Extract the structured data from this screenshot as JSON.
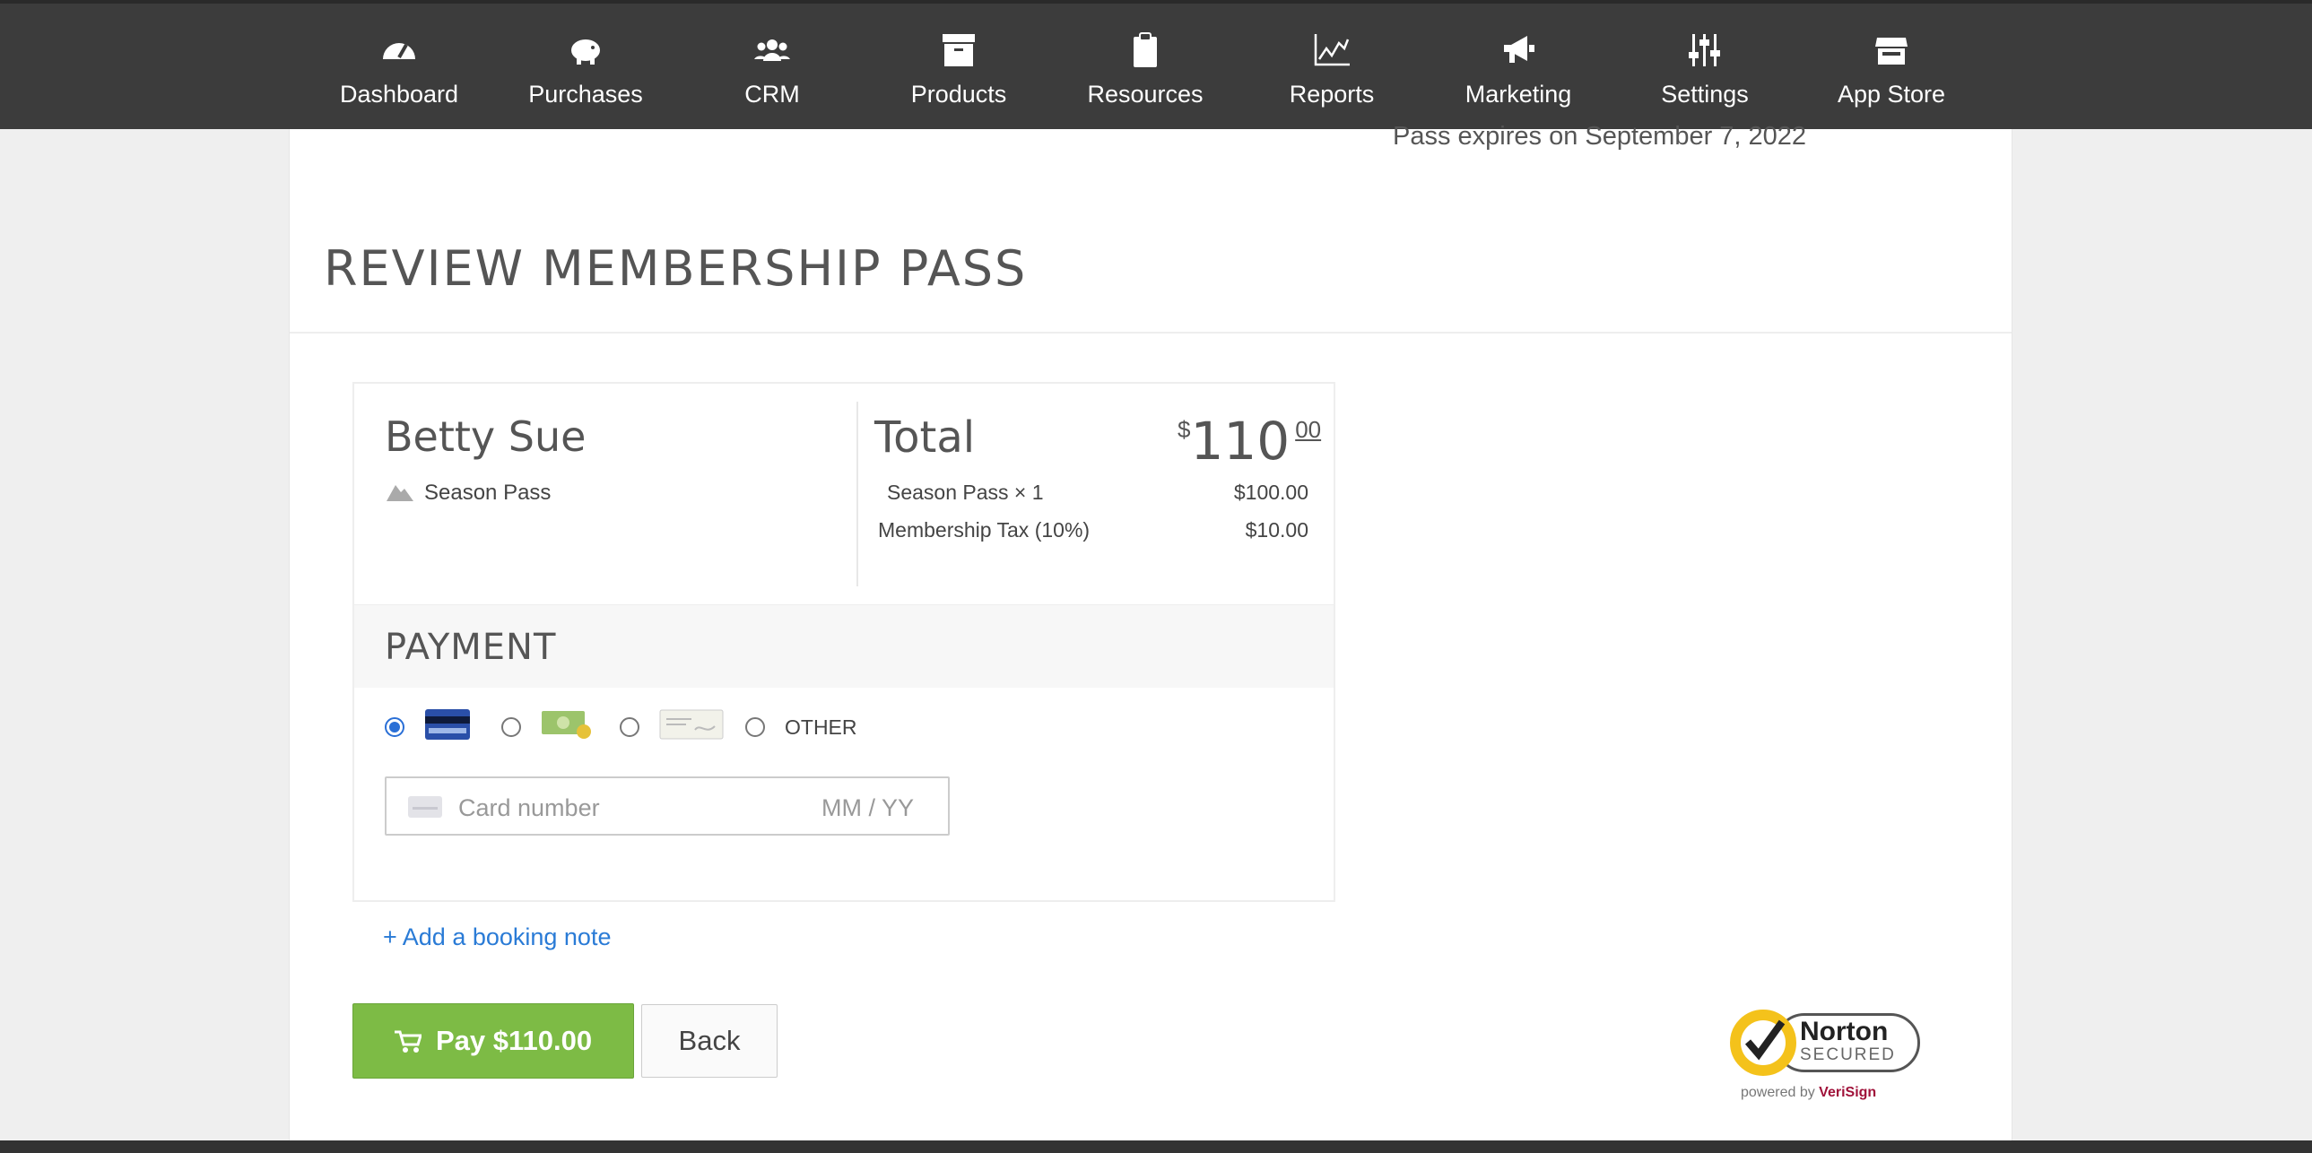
{
  "nav": {
    "items": [
      {
        "label": "Dashboard",
        "icon": "dashboard-gauge-icon"
      },
      {
        "label": "Purchases",
        "icon": "piggy-bank-icon"
      },
      {
        "label": "CRM",
        "icon": "people-icon"
      },
      {
        "label": "Products",
        "icon": "archive-box-icon"
      },
      {
        "label": "Resources",
        "icon": "clipboard-icon"
      },
      {
        "label": "Reports",
        "icon": "line-chart-icon"
      },
      {
        "label": "Marketing",
        "icon": "megaphone-icon"
      },
      {
        "label": "Settings",
        "icon": "sliders-icon"
      },
      {
        "label": "App Store",
        "icon": "storefront-icon"
      }
    ]
  },
  "header": {
    "expires": "Pass expires on September 7, 2022",
    "title": "REVIEW MEMBERSHIP PASS"
  },
  "summary": {
    "customer_name": "Betty Sue",
    "pass_name": "Season Pass",
    "total_label": "Total",
    "currency_symbol": "$",
    "total_int": "110",
    "total_cents": "00",
    "lines": [
      {
        "label": "Season Pass × 1",
        "amount": "$100.00"
      },
      {
        "label": "Membership Tax (10%)",
        "amount": "$10.00"
      }
    ]
  },
  "payment": {
    "title": "PAYMENT",
    "methods": [
      "credit-card-icon",
      "cash-icon",
      "check-icon",
      "other"
    ],
    "other_label": "OTHER",
    "selected": "credit-card",
    "card_placeholder": "Card number",
    "expiry_placeholder": "MM / YY"
  },
  "actions": {
    "booking_note": "+ Add a booking note",
    "pay_label": "Pay $110.00",
    "back_label": "Back"
  },
  "badge": {
    "brand": "Norton",
    "secured": "SECURED",
    "powered_by": "powered by",
    "partner": "VeriSign"
  },
  "colors": {
    "nav_bg": "#3c3c3c",
    "accent_link": "#2a7bd6",
    "pay_green": "#7dbb45",
    "radio_selected": "#2a6fd6"
  }
}
